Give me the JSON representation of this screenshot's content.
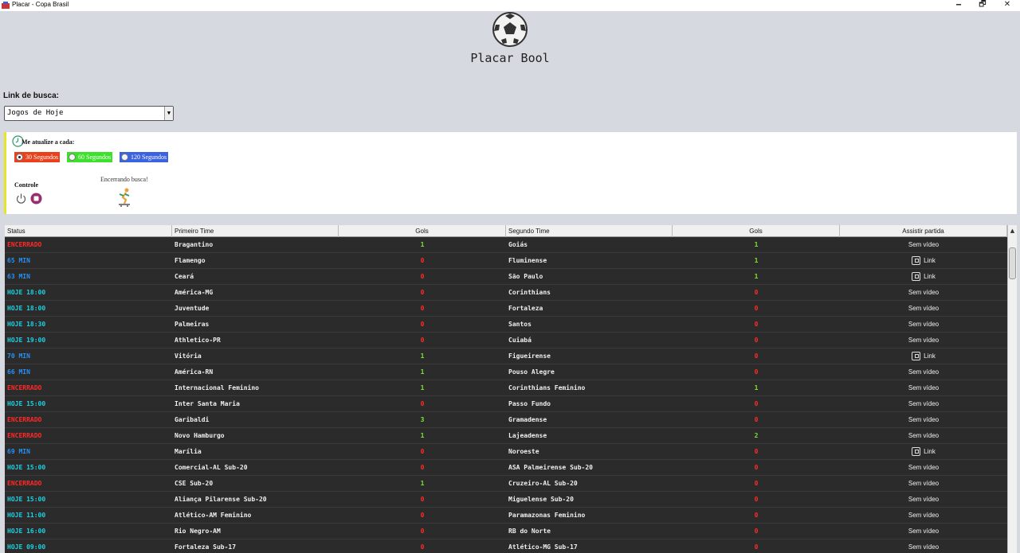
{
  "window": {
    "title": "Placar - Copa Brasil",
    "minimize": "🗕",
    "maximize": "🗗",
    "close": "✕"
  },
  "header": {
    "title": "Placar Bool"
  },
  "search": {
    "label": "Link de busca:",
    "selected": "Jogos de Hoje"
  },
  "refresh": {
    "label": "Me atualize a cada:",
    "options": [
      {
        "label": "30 Segundos",
        "color": "#e8411c",
        "checked": true
      },
      {
        "label": "60 Segundos",
        "color": "#3de02a",
        "checked": false
      },
      {
        "label": "120 Segundos",
        "color": "#3b63e0",
        "checked": false
      }
    ]
  },
  "control": {
    "label": "Controle",
    "status_message": "Encerrando busca!"
  },
  "table": {
    "headers": [
      "Status",
      "Primeiro Time",
      "Gols",
      "Segundo Time",
      "Gols",
      "Assistir partida"
    ],
    "colors": {
      "ended": "#ff2a2a",
      "live": "#2a8ff0",
      "scheduled": "#1ecfe0",
      "goal_positive": "#7ee03a",
      "goal_zero": "#ff2a2a"
    },
    "rows": [
      {
        "status": "ENCERRADO",
        "kind": "ended",
        "team1": "Bragantino",
        "goals1": "1",
        "team2": "Goiás",
        "goals2": "1",
        "watch": "Sem vídeo"
      },
      {
        "status": "65 MIN",
        "kind": "live",
        "team1": "Flamengo",
        "goals1": "0",
        "team2": "Fluminense",
        "goals2": "1",
        "watch": "Link"
      },
      {
        "status": "63 MIN",
        "kind": "live",
        "team1": "Ceará",
        "goals1": "0",
        "team2": "São Paulo",
        "goals2": "1",
        "watch": "Link"
      },
      {
        "status": "HOJE 18:00",
        "kind": "scheduled",
        "team1": "América-MG",
        "goals1": "0",
        "team2": "Corinthians",
        "goals2": "0",
        "watch": "Sem vídeo"
      },
      {
        "status": "HOJE 18:00",
        "kind": "scheduled",
        "team1": "Juventude",
        "goals1": "0",
        "team2": "Fortaleza",
        "goals2": "0",
        "watch": "Sem vídeo"
      },
      {
        "status": "HOJE 18:30",
        "kind": "scheduled",
        "team1": "Palmeiras",
        "goals1": "0",
        "team2": "Santos",
        "goals2": "0",
        "watch": "Sem vídeo"
      },
      {
        "status": "HOJE 19:00",
        "kind": "scheduled",
        "team1": "Athletico-PR",
        "goals1": "0",
        "team2": "Cuiabá",
        "goals2": "0",
        "watch": "Sem vídeo"
      },
      {
        "status": "70 MIN",
        "kind": "live",
        "team1": "Vitória",
        "goals1": "1",
        "team2": "Figueirense",
        "goals2": "0",
        "watch": "Link"
      },
      {
        "status": "66 MIN",
        "kind": "live",
        "team1": "América-RN",
        "goals1": "1",
        "team2": "Pouso Alegre",
        "goals2": "0",
        "watch": "Sem vídeo"
      },
      {
        "status": "ENCERRADO",
        "kind": "ended",
        "team1": "Internacional Feminino",
        "goals1": "1",
        "team2": "Corinthians Feminino",
        "goals2": "1",
        "watch": "Sem vídeo"
      },
      {
        "status": "HOJE 15:00",
        "kind": "scheduled",
        "team1": "Inter Santa Maria",
        "goals1": "0",
        "team2": "Passo Fundo",
        "goals2": "0",
        "watch": "Sem vídeo"
      },
      {
        "status": "ENCERRADO",
        "kind": "ended",
        "team1": "Garibaldi",
        "goals1": "3",
        "team2": "Gramadense",
        "goals2": "0",
        "watch": "Sem vídeo"
      },
      {
        "status": "ENCERRADO",
        "kind": "ended",
        "team1": "Novo Hamburgo",
        "goals1": "1",
        "team2": "Lajeadense",
        "goals2": "2",
        "watch": "Sem vídeo"
      },
      {
        "status": "69 MIN",
        "kind": "live",
        "team1": "Marília",
        "goals1": "0",
        "team2": "Noroeste",
        "goals2": "0",
        "watch": "Link"
      },
      {
        "status": "HOJE 15:00",
        "kind": "scheduled",
        "team1": "Comercial-AL Sub-20",
        "goals1": "0",
        "team2": "ASA Palmeirense Sub-20",
        "goals2": "0",
        "watch": "Sem vídeo"
      },
      {
        "status": "ENCERRADO",
        "kind": "ended",
        "team1": "CSE Sub-20",
        "goals1": "1",
        "team2": "Cruzeiro-AL Sub-20",
        "goals2": "0",
        "watch": "Sem vídeo"
      },
      {
        "status": "HOJE 15:00",
        "kind": "scheduled",
        "team1": "Aliança Pilarense Sub-20",
        "goals1": "0",
        "team2": "Miguelense Sub-20",
        "goals2": "0",
        "watch": "Sem vídeo"
      },
      {
        "status": "HOJE 11:00",
        "kind": "scheduled",
        "team1": "Atlético-AM Feminino",
        "goals1": "0",
        "team2": "Paramazonas Feminino",
        "goals2": "0",
        "watch": "Sem vídeo"
      },
      {
        "status": "HOJE 16:00",
        "kind": "scheduled",
        "team1": "Rio Negro-AM",
        "goals1": "0",
        "team2": "RB do Norte",
        "goals2": "0",
        "watch": "Sem vídeo"
      },
      {
        "status": "HOJE 09:00",
        "kind": "scheduled",
        "team1": "Fortaleza Sub-17",
        "goals1": "0",
        "team2": "Atlético-MG Sub-17",
        "goals2": "0",
        "watch": "Sem vídeo"
      }
    ]
  }
}
